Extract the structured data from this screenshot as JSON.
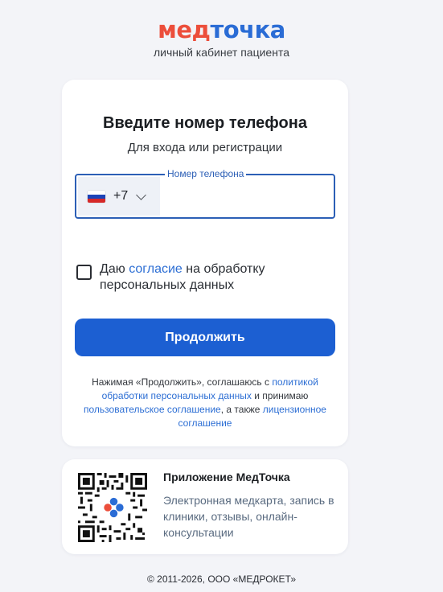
{
  "brand": {
    "logo_part1": "мед",
    "logo_part2": "точка",
    "subtitle": "личный кабинет пациента",
    "accent_red": "#ec4e3b",
    "accent_blue": "#2a6cd5"
  },
  "login": {
    "title": "Введите номер телефона",
    "hint": "Для входа или регистрации",
    "phone_legend": "Номер телефона",
    "country_flag": "russia-flag-icon",
    "country_code": "+7",
    "phone_value": "",
    "consent_prefix": "Даю ",
    "consent_link": "согласие",
    "consent_suffix": " на обработку персональных данных",
    "consent_checked": false,
    "continue_label": "Продолжить",
    "button_color": "#1c5fd2"
  },
  "legal": {
    "t1": "Нажимая «Продолжить», соглашаюсь с ",
    "l1": "политикой обработки персональных данных",
    "t2": " и принимаю ",
    "l2": "пользовательское соглашение",
    "t3": ", а также ",
    "l3": "лицензионное соглашение"
  },
  "app": {
    "title": "Приложение МедТочка",
    "description": "Электронная медкарта, запись в клиники, отзывы, онлайн-консультации",
    "qr_icon": "qr-code-icon"
  },
  "footer": {
    "copyright": "© 2011-2026, ООО «МЕДРОКЕТ»"
  }
}
